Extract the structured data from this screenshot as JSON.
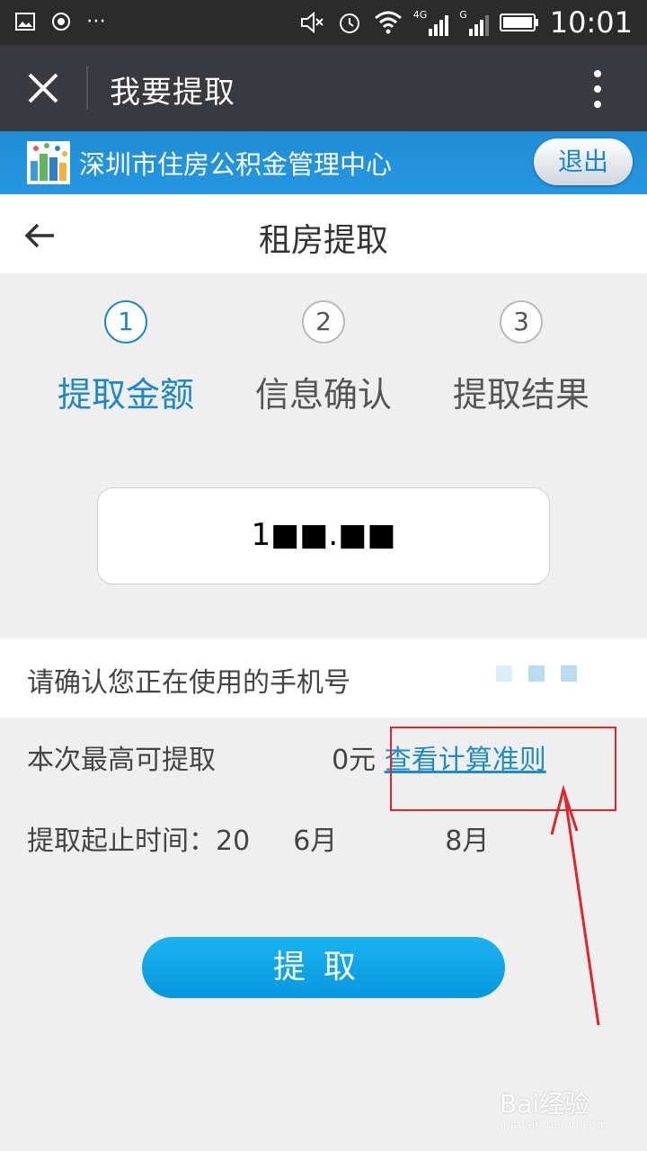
{
  "status_bar": {
    "time": "10:01",
    "network_1": "4G",
    "network_2": "G"
  },
  "wechat_header": {
    "title": "我要提取"
  },
  "banner": {
    "org_name": "深圳市住房公积金管理中心",
    "logout_label": "退出"
  },
  "page": {
    "title": "租房提取"
  },
  "steps": [
    {
      "number": "1",
      "label": "提取金额"
    },
    {
      "number": "2",
      "label": "信息确认"
    },
    {
      "number": "3",
      "label": "提取结果"
    }
  ],
  "amount": {
    "value": "1■■.■■"
  },
  "phone_confirm": {
    "text": "请确认您正在使用的手机号"
  },
  "max_withdraw": {
    "prefix": "本次最高可提取",
    "suffix": "0元",
    "link_label": "查看计算准则"
  },
  "period": {
    "label": "提取起止时间：",
    "value_start": "20",
    "value_mid": "6月",
    "value_end": "8月"
  },
  "withdraw_button": {
    "label": "提取"
  },
  "watermark": {
    "main": "Bai经验",
    "sub": "jingyan.baidu.com"
  },
  "colors": {
    "accent": "#1e88c7",
    "banner": "#1f8ed6",
    "annotation": "#e0262a"
  }
}
